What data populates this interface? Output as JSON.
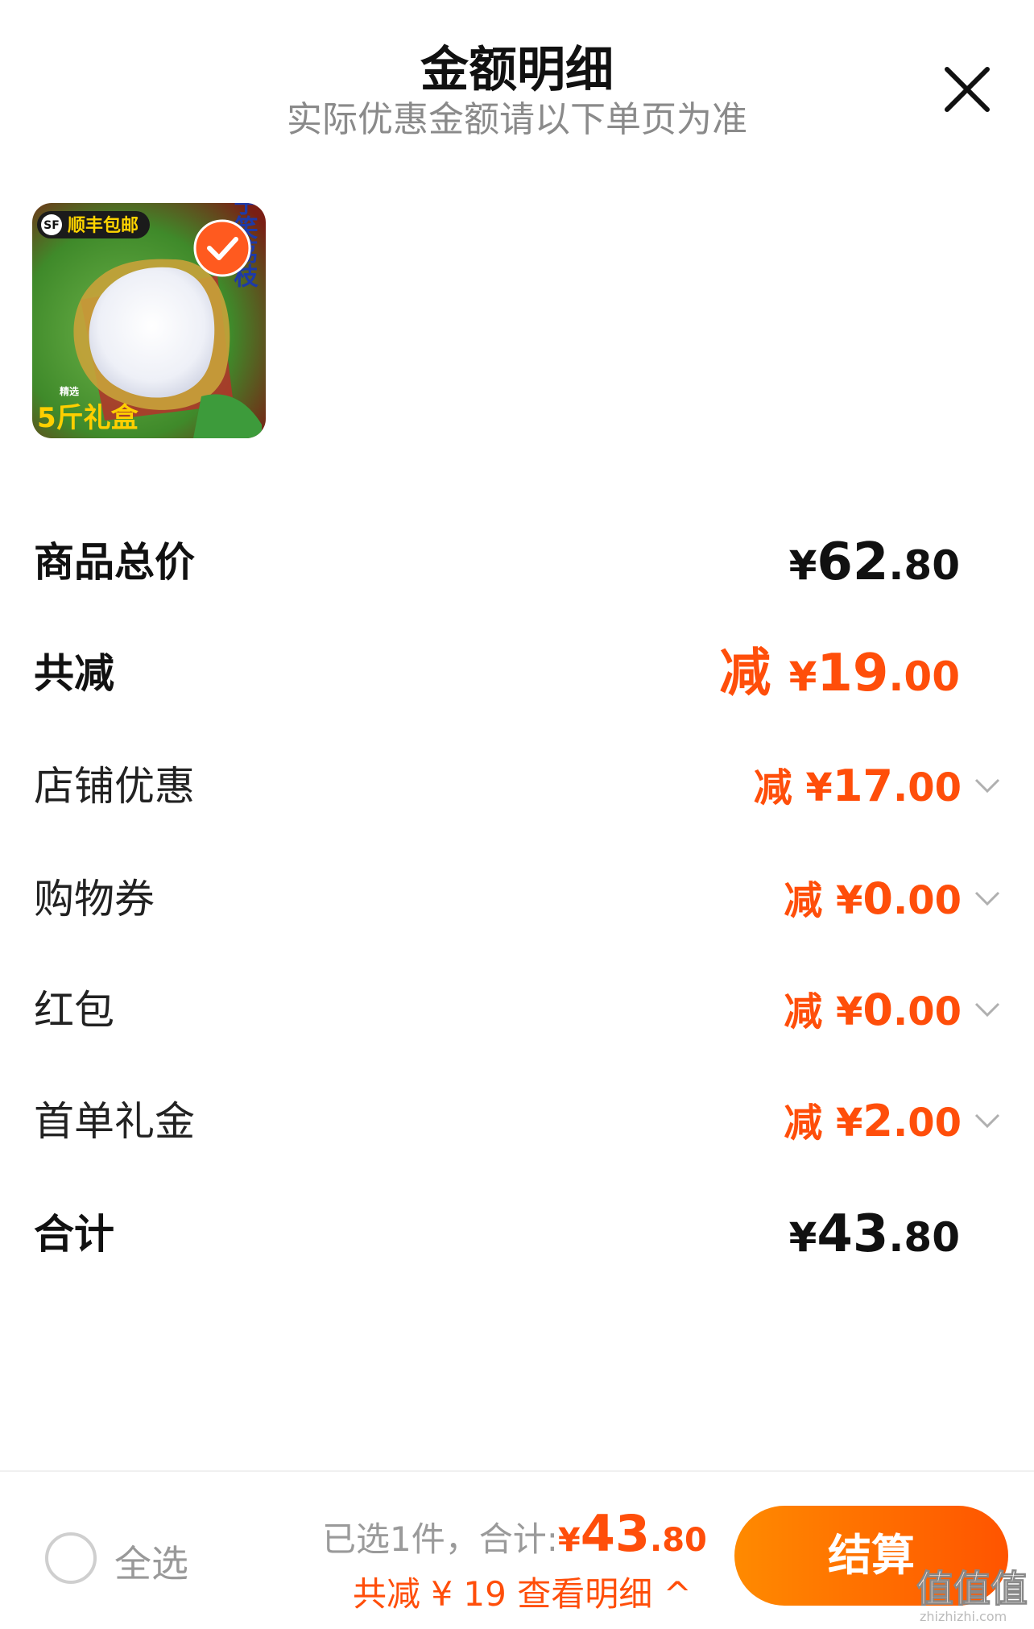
{
  "header": {
    "title": "金额明细",
    "subtitle": "实际优惠金额请以下单页为准",
    "close_icon": "close-icon"
  },
  "product": {
    "badge": "顺丰包邮",
    "side_text": "妃子笑荔枝",
    "box_text": "5斤礼盒",
    "tag": "精选",
    "selected": true
  },
  "rows": [
    {
      "label": "商品总价",
      "yen": "¥",
      "int": "62",
      "dec": ".80"
    },
    {
      "label": "共减",
      "prefix": "减 ",
      "yen": "¥",
      "int": "19",
      "dec": ".00"
    },
    {
      "label": "店铺优惠",
      "prefix": "减 ",
      "yen": "¥",
      "int": "17",
      "dec": ".00"
    },
    {
      "label": "购物券",
      "prefix": "减 ",
      "yen": "¥",
      "int": "0",
      "dec": ".00"
    },
    {
      "label": "红包",
      "prefix": "减 ",
      "yen": "¥",
      "int": "0",
      "dec": ".00"
    },
    {
      "label": "首单礼金",
      "prefix": "减 ",
      "yen": "¥",
      "int": "2",
      "dec": ".00"
    },
    {
      "label": "合计",
      "yen": "¥",
      "int": "43",
      "dec": ".80"
    }
  ],
  "bottom": {
    "select_all": "全选",
    "selected_text": "已选1件，合计:",
    "total_yen": "¥",
    "total_int": "43",
    "total_dec": ".80",
    "savings_text": "共减 ¥ 19 查看明细 ^",
    "checkout_label": "结算"
  },
  "watermark": "值",
  "colors": {
    "accent": "#ff4e0a",
    "checkout_start": "#ff8a00",
    "checkout_end": "#ff5400"
  }
}
